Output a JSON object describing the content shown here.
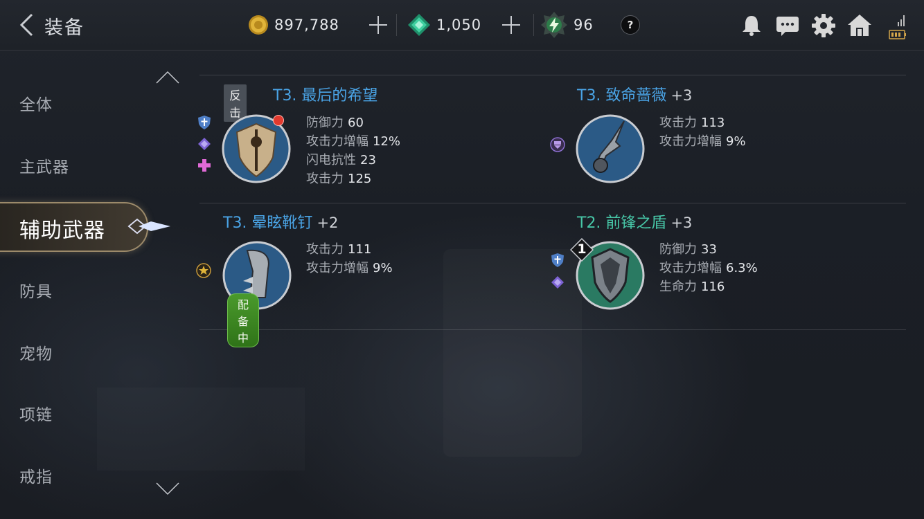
{
  "header": {
    "title": "装备",
    "gold": "897,788",
    "gems": "1,050",
    "energy": "96",
    "help": "?"
  },
  "sidebar": {
    "items": [
      {
        "label": "全体"
      },
      {
        "label": "主武器"
      },
      {
        "label": "辅助武器",
        "active": true
      },
      {
        "label": "防具"
      },
      {
        "label": "宠物"
      },
      {
        "label": "项链"
      },
      {
        "label": "戒指"
      }
    ]
  },
  "items": [
    {
      "tag": "反击",
      "name": "T3. 最后的希望",
      "plus": "",
      "stats": [
        {
          "label": "防御力",
          "value": "60"
        },
        {
          "label": "攻击力增幅",
          "value": "12%"
        },
        {
          "label": "闪电抗性",
          "value": "23"
        },
        {
          "label": "攻击力",
          "value": "125"
        }
      ]
    },
    {
      "name": "T3. 致命蔷薇",
      "plus": "+3",
      "stats": [
        {
          "label": "攻击力",
          "value": "113"
        },
        {
          "label": "攻击力增幅",
          "value": "9%"
        }
      ]
    },
    {
      "name": "T3. 晕眩靴钉",
      "plus": "+2",
      "equipped": "配备中",
      "stats": [
        {
          "label": "攻击力",
          "value": "111"
        },
        {
          "label": "攻击力增幅",
          "value": "9%"
        }
      ]
    },
    {
      "name": "T2. 前锋之盾",
      "plus": "+3",
      "level": "1",
      "stats": [
        {
          "label": "防御力",
          "value": "33"
        },
        {
          "label": "攻击力增幅",
          "value": "6.3%"
        },
        {
          "label": "生命力",
          "value": "116"
        }
      ]
    }
  ],
  "colors": {
    "name_blue": "#4aa4e6",
    "name_green": "#47c6a7",
    "equipped_green": "#3f8c27"
  }
}
